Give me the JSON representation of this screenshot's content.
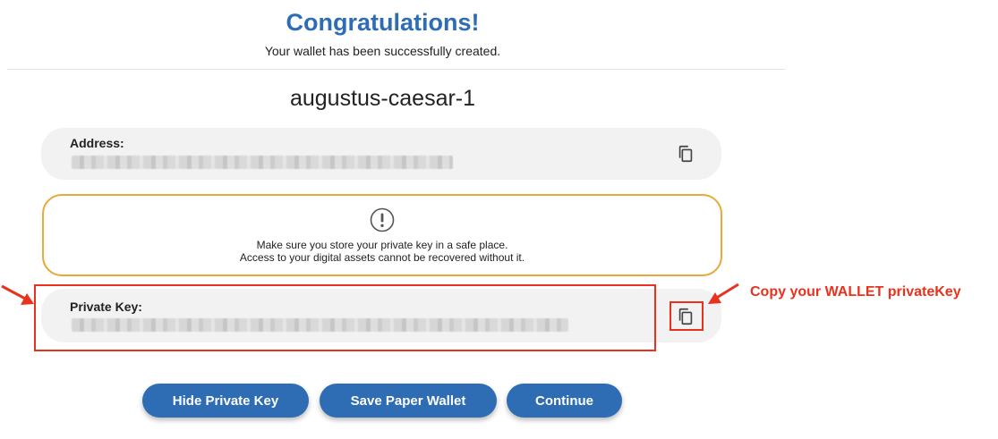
{
  "header": {
    "title": "Congratulations!",
    "subtitle": "Your wallet has been successfully created."
  },
  "wallet": {
    "name": "augustus-caesar-1"
  },
  "address": {
    "label": "Address:",
    "copy_icon": "copy-icon"
  },
  "warning": {
    "icon": "exclamation-circle-icon",
    "line1": "Make sure you store your private key in a safe place.",
    "line2": "Access to your digital assets cannot be recovered without it.",
    "border_color": "#e8a83a"
  },
  "private_key": {
    "label": "Private Key:",
    "copy_icon": "copy-icon"
  },
  "annotation": {
    "text": "Copy your WALLET privateKey",
    "color": "#e8321e"
  },
  "buttons": {
    "hide_private_key": "Hide Private Key",
    "save_paper_wallet": "Save Paper Wallet",
    "continue": "Continue"
  },
  "colors": {
    "accent": "#2e6db4",
    "field_background": "#f2f2f2"
  }
}
